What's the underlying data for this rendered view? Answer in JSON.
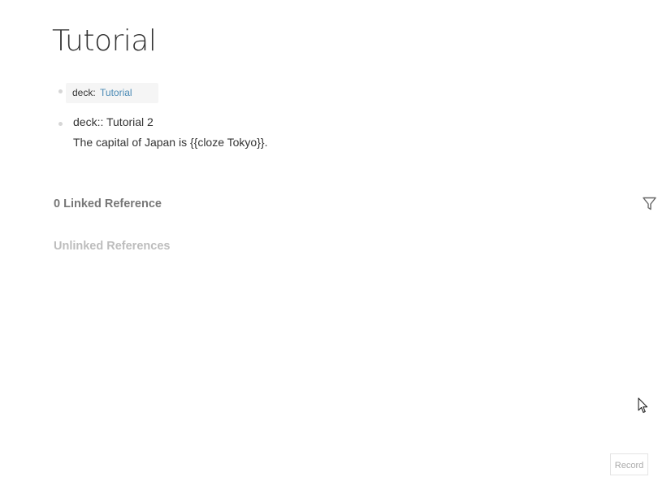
{
  "page": {
    "title": "Tutorial"
  },
  "blocks": [
    {
      "property_key": "deck:",
      "property_value": "Tutorial"
    },
    {
      "line1": "deck:: Tutorial 2",
      "line2": "The capital of Japan is {{cloze Tokyo}}."
    }
  ],
  "references": {
    "linked_label": "0 Linked Reference",
    "unlinked_label": "Unlinked References"
  },
  "icons": {
    "filter": "filter-icon",
    "cursor": "mouse-cursor-icon"
  },
  "record_button": {
    "label": "Record"
  },
  "colors": {
    "link": "#4a8ab5",
    "muted": "#777777",
    "faint": "#bdbdbd"
  }
}
